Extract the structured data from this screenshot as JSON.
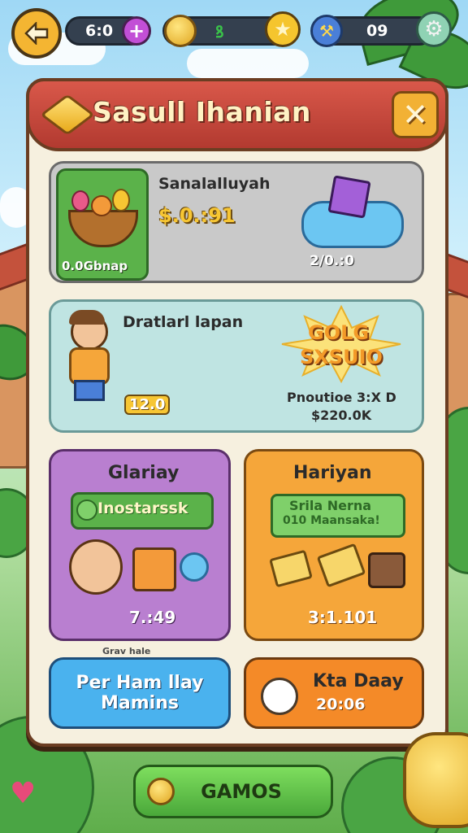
{
  "topbar": {
    "lives_value": "6:0",
    "coins_value": "",
    "gems_value": "09"
  },
  "panel": {
    "title": "Sasull Ihanian"
  },
  "cards": [
    {
      "title": "Sanalalluyah",
      "price": "$.0.:91",
      "badge": "0.0Gbnap",
      "right_value": "2/0.:0"
    },
    {
      "title": "Dratlarl lapan",
      "level": "12.0",
      "burst_line1": "GOLG",
      "burst_line2": "SXSUIO",
      "promo_line1": "Pnoutioe 3:X D",
      "promo_line2": "$220.0K"
    },
    {
      "title": "Glariay",
      "banner": "Inostarssk",
      "value": "7.:49",
      "footer_note": "Grav hale"
    },
    {
      "title": "Hariyan",
      "bubble_line1": "Srila Nerna",
      "bubble_line2": "010 Maansaka!",
      "value": "3:1.101"
    }
  ],
  "buttons": {
    "left_line1": "Per Ham llay",
    "left_line2": "Mamins",
    "right_line1": "Kta Daay",
    "right_line2": "20:06",
    "bottom": "GAMOS"
  },
  "colors": {
    "panel_header": "#c7463a",
    "card_green": "#5bb24a",
    "card_teal": "#bfe4e2",
    "card_purple": "#b97fd0",
    "card_orange": "#f5a63a",
    "btn_blue": "#4ab2ee",
    "btn_orange": "#f48a28",
    "btn_green": "#5cc24a"
  }
}
